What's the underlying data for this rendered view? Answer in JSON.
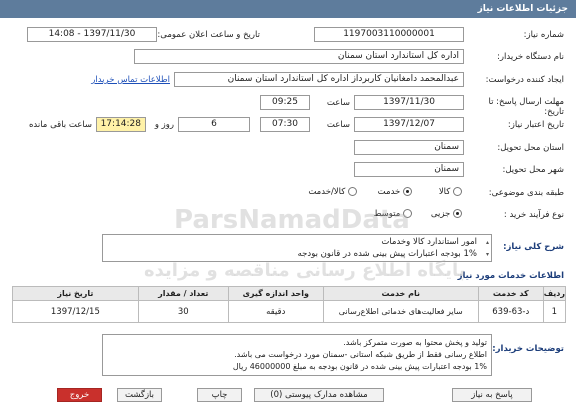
{
  "page_title": "جزئیات اطلاعات نیاز",
  "fields": {
    "need_number_label": "شماره نیاز:",
    "need_number": "1197003110000001",
    "announce_label": "تاریخ و ساعت اعلان عمومی:",
    "announce_value": "1397/11/30 - 14:08",
    "buyer_label": "نام دستگاه خریدار:",
    "buyer_value": "اداره کل استاندارد استان سمنان",
    "creator_label": "ایجاد کننده درخواست:",
    "creator_value": "عبدالمحمد دامغانیان کاربرداز اداره کل استاندارد استان سمنان",
    "contact_link": "اطلاعات تماس خریدار",
    "response_deadline_label": "مهلت ارسال پاسخ: تا تاریخ:",
    "response_date": "1397/11/30",
    "time_label": "ساعت",
    "response_time": "09:25",
    "validity_label": "تاریخ اعتبار نیاز:",
    "validity_date": "1397/12/07",
    "validity_time": "07:30",
    "days_value": "6",
    "days_label": "روز و",
    "remaining_time": "17:14:28",
    "remaining_label": "ساعت باقی مانده",
    "province_label": "استان محل تحویل:",
    "province_value": "سمنان",
    "city_label": "شهر محل تحویل:",
    "city_value": "سمنان",
    "category_label": "طبقه بندی موضوعی:",
    "category_options": [
      "کالا",
      "خدمت",
      "کالا/خدمت"
    ],
    "category_selected": "خدمت",
    "process_label": "نوع فرآیند خرید :",
    "process_options": [
      "جزیی",
      "متوسط"
    ],
    "process_selected": "جزیی"
  },
  "summary": {
    "label": "شرح کلی نیاز:",
    "line1": "امور استاندارد کالا وخدمات",
    "line2": "1% بودجه اعتبارات پیش بینی شده در قانون بودجه"
  },
  "services_title": "اطلاعات خدمات مورد نیاز",
  "table": {
    "headers": [
      "ردیف",
      "کد خدمت",
      "نام خدمت",
      "واحد اندازه گیری",
      "تعداد / مقدار",
      "تاریخ نیاز"
    ],
    "rows": [
      [
        "1",
        "د-63-639",
        "سایر فعالیت‌های خدماتی اطلاع‌رسانی",
        "دقیقه",
        "30",
        "1397/12/15"
      ]
    ]
  },
  "notes": {
    "label": "توضیحات خریدار:",
    "line1": "تولید و پخش محتوا به صورت متمرکز باشد.",
    "line2": "اطلاع رسانی فقط از طریق شبکه استانی -سمنان مورد درخواست می باشد.",
    "line3": "1% بودجه اعتبارات پیش بینی شده در قانون بودجه  به مبلغ 46000000 ریال"
  },
  "buttons": {
    "reply": "پاسخ به نیاز",
    "view_docs": "مشاهده مدارک پیوستی (0)",
    "print": "چاپ",
    "back": "بازگشت",
    "exit": "خروج"
  },
  "watermark": {
    "brand": "ParsNamadData",
    "text": "پایگاه اطلاع رسانی مناقصه و مزایده"
  },
  "colors": {
    "header_bg": "#5e7c9c",
    "label_blue": "#1c3d7a",
    "remaining_bg": "#fff2a8",
    "danger_btn": "#c9302c"
  }
}
